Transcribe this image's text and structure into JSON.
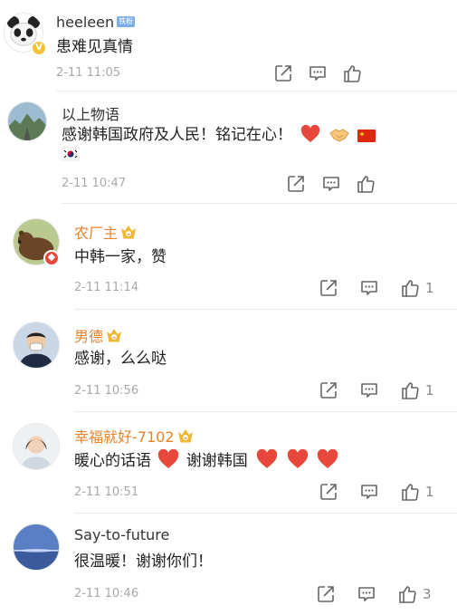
{
  "comments": [
    {
      "user": "heeleen",
      "badge": "铁粉",
      "text": "患难见真情",
      "time": "2-11 11:05",
      "likes": ""
    },
    {
      "user": "以上物语",
      "text": "感谢韩国政府及人民！铭记在心！",
      "time": "2-11 10:47",
      "likes": ""
    },
    {
      "user": "农厂主",
      "text": "中韩一家，赞",
      "time": "2-11 11:14",
      "likes": "1"
    },
    {
      "user": "男德",
      "text": "感谢，么么哒",
      "time": "2-11 10:56",
      "likes": "1"
    },
    {
      "user": "幸福就好-7102",
      "text_a": "暖心的话语",
      "text_b": "谢谢韩国",
      "time": "2-11 10:51",
      "likes": "1"
    },
    {
      "user": "Say-to-future",
      "text": "很温暖！谢谢你们！",
      "time": "2-11 10:46",
      "likes": "3"
    }
  ],
  "colors": {
    "vip_name": "#e8822d",
    "time": "#a9a9a9",
    "icon": "#666666",
    "heart": "#e8473c"
  },
  "icons": [
    "share-icon",
    "comment-icon",
    "like-icon"
  ]
}
